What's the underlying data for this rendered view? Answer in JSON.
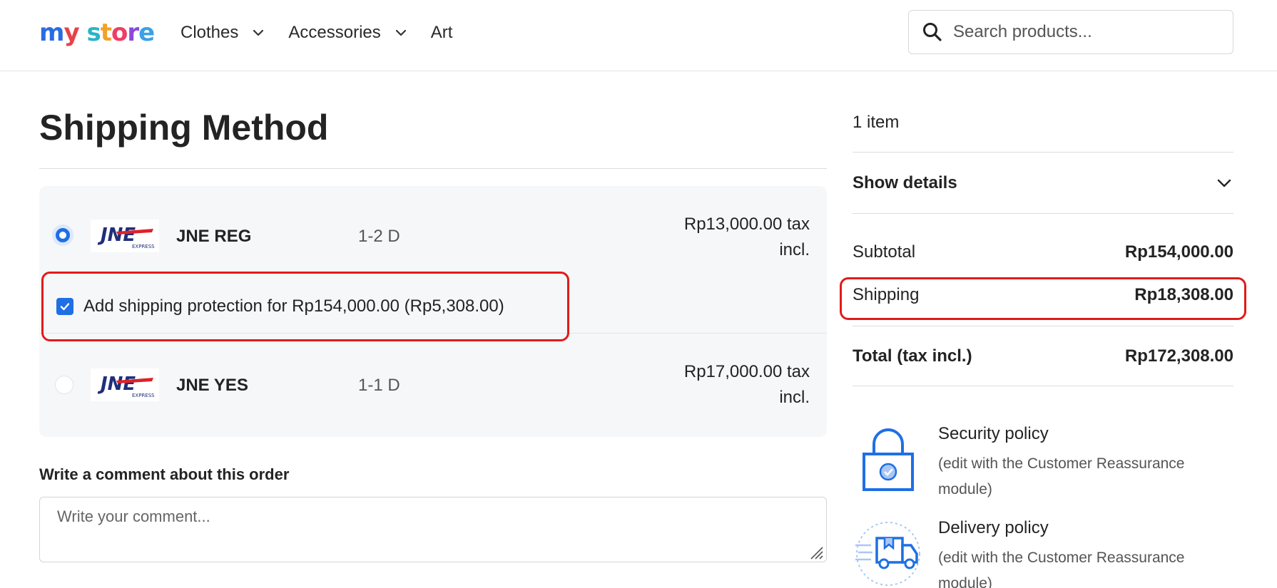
{
  "header": {
    "logo_text": "my store",
    "nav": [
      {
        "label": "Clothes",
        "has_dropdown": true
      },
      {
        "label": "Accessories",
        "has_dropdown": true
      },
      {
        "label": "Art",
        "has_dropdown": false
      }
    ],
    "search": {
      "placeholder": "Search products...",
      "value": "",
      "icon": "search-icon"
    }
  },
  "main": {
    "title": "Shipping Method",
    "carriers": [
      {
        "name": "JNE REG",
        "delay": "1-2 D",
        "price_line1": "Rp13,000.00 tax",
        "price_line2": "incl.",
        "selected": true,
        "logo": "jne-express-logo"
      },
      {
        "name": "JNE YES",
        "delay": "1-1 D",
        "price_line1": "Rp17,000.00 tax",
        "price_line2": "incl.",
        "selected": false,
        "logo": "jne-express-logo"
      }
    ],
    "protection": {
      "label": "Add shipping protection for Rp154,000.00 (Rp5,308.00)",
      "checked": true
    },
    "comment": {
      "label": "Write a comment about this order",
      "placeholder": "Write your comment...",
      "value": ""
    }
  },
  "summary": {
    "items_count": "1 item",
    "show_details": "Show details",
    "subtotal": {
      "label": "Subtotal",
      "value": "Rp154,000.00"
    },
    "shipping": {
      "label": "Shipping",
      "value": "Rp18,308.00"
    },
    "total": {
      "label": "Total (tax incl.)",
      "value": "Rp172,308.00"
    },
    "reassurance": [
      {
        "title": "Security policy",
        "desc": "(edit with the Customer Reassurance module)",
        "icon": "lock-icon"
      },
      {
        "title": "Delivery policy",
        "desc": "(edit with the Customer Reassurance module)",
        "icon": "delivery-truck-icon"
      }
    ]
  },
  "colors": {
    "accent": "#1f6fe5",
    "highlight": "#e01b1b",
    "panel_bg": "#f6f7f9"
  }
}
